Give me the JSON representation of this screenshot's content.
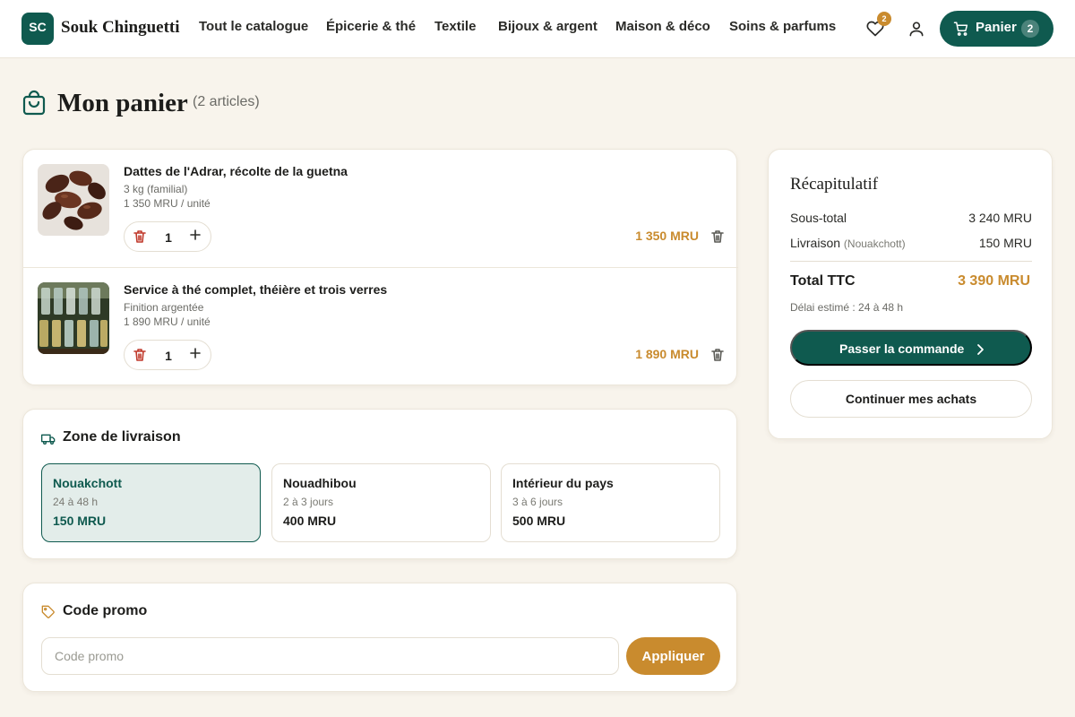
{
  "brand": {
    "initials": "SC",
    "name": "Souk Chinguetti"
  },
  "nav": {
    "items": [
      "Tout le catalogue",
      "Épicerie & thé",
      "Textile",
      "Bijoux & argent",
      "Maison & déco",
      "Soins & parfums"
    ]
  },
  "header": {
    "favorites_count": "2",
    "cart_label": "Panier",
    "cart_count": "2"
  },
  "page": {
    "title": "Mon panier",
    "count": "(2 articles)"
  },
  "cart": {
    "items": [
      {
        "name": "Dattes de l'Adrar, récolte de la guetna",
        "variant": "3 kg (familial)",
        "unit_price": "1 350 MRU / unité",
        "quantity": "1",
        "total": "1 350 MRU"
      },
      {
        "name": "Service à thé complet, théière et trois verres",
        "variant": "Finition argentée",
        "unit_price": "1 890 MRU / unité",
        "quantity": "1",
        "total": "1 890 MRU"
      }
    ]
  },
  "delivery": {
    "title": "Zone de livraison",
    "zones": [
      {
        "name": "Nouakchott",
        "delay": "24 à 48 h",
        "price": "150 MRU",
        "selected": true
      },
      {
        "name": "Nouadhibou",
        "delay": "2 à 3 jours",
        "price": "400 MRU",
        "selected": false
      },
      {
        "name": "Intérieur du pays",
        "delay": "3 à 6 jours",
        "price": "500 MRU",
        "selected": false
      }
    ]
  },
  "promo": {
    "title": "Code promo",
    "placeholder": "Code promo",
    "apply_label": "Appliquer"
  },
  "summary": {
    "title": "Récapitulatif",
    "subtotal_label": "Sous-total",
    "subtotal_value": "3 240 MRU",
    "shipping_label": "Livraison",
    "shipping_zone": "(Nouakchott)",
    "shipping_value": "150 MRU",
    "total_label": "Total TTC",
    "total_value": "3 390 MRU",
    "delay": "Délai estimé : 24 à 48 h",
    "checkout_label": "Passer la commande",
    "continue_label": "Continuer mes achats"
  },
  "colors": {
    "primary": "#0f5a4f",
    "accent": "#c98b2e",
    "background": "#f8f4ec"
  },
  "icons": {
    "heart": "heart-icon",
    "user": "user-icon",
    "cart": "cart-icon",
    "bag": "shopping-bag-icon",
    "trash": "trash-icon",
    "plus": "plus-icon",
    "truck": "truck-icon",
    "tag": "tag-icon",
    "chevron": "chevron-right-icon"
  }
}
